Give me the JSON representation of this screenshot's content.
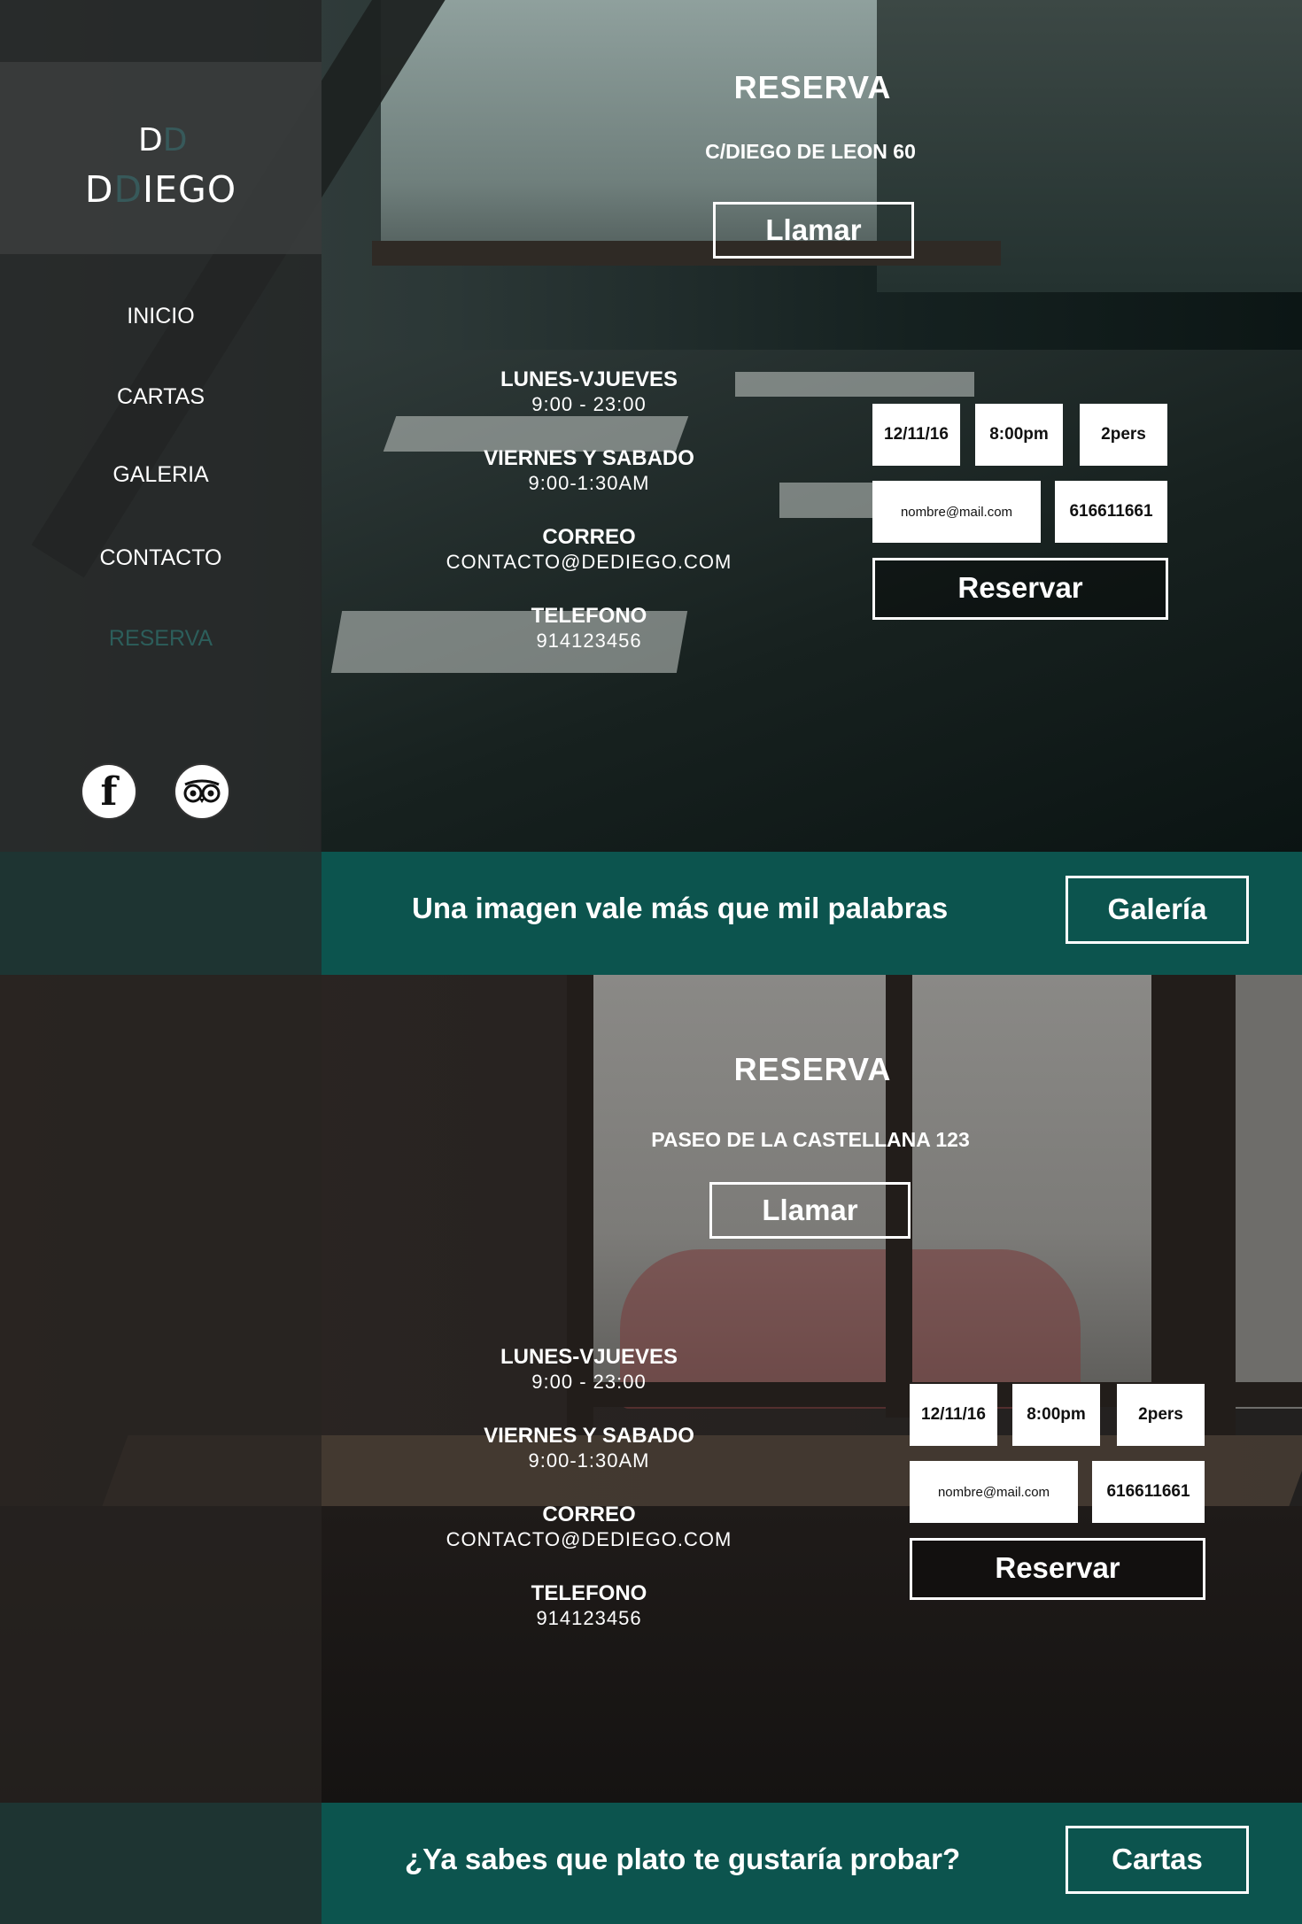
{
  "brand": {
    "mark_first": "D",
    "mark_second": "D",
    "name_first": "D",
    "name_second": "D",
    "name_rest": "IEGO"
  },
  "sidebar": {
    "nav": [
      {
        "label": "INICIO"
      },
      {
        "label": "CARTAS"
      },
      {
        "label": "GALERIA"
      },
      {
        "label": "CONTACTO"
      },
      {
        "label": "RESERVA",
        "active": true
      }
    ],
    "social": {
      "facebook_glyph": "f",
      "facebook_icon": "facebook-icon",
      "tripadvisor_icon": "tripadvisor-icon"
    }
  },
  "section1": {
    "title": "RESERVA",
    "address": "C/DIEGO DE LEON 60",
    "call_label": "Llamar",
    "hours": [
      {
        "heading": "LUNES-VJUEVES",
        "value": "9:00 - 23:00"
      },
      {
        "heading": "VIERNES Y SABADO",
        "value": "9:00-1:30AM"
      },
      {
        "heading": "CORREO",
        "value": "CONTACTO@DEDIEGO.COM"
      },
      {
        "heading": "TELEFONO",
        "value": "914123456"
      }
    ],
    "form": {
      "date": "12/11/16",
      "time": "8:00pm",
      "people": "2pers",
      "email": "nombre@mail.com",
      "phone": "616611661",
      "submit": "Reservar"
    }
  },
  "banner1": {
    "text": "Una imagen vale más que mil palabras",
    "button": "Galería"
  },
  "section2": {
    "title": "RESERVA",
    "address": "PASEO DE LA CASTELLANA 123",
    "call_label": "Llamar",
    "hours": [
      {
        "heading": "LUNES-VJUEVES",
        "value": "9:00 - 23:00"
      },
      {
        "heading": "VIERNES Y SABADO",
        "value": "9:00-1:30AM"
      },
      {
        "heading": "CORREO",
        "value": "CONTACTO@DEDIEGO.COM"
      },
      {
        "heading": "TELEFONO",
        "value": "914123456"
      }
    ],
    "form": {
      "date": "12/11/16",
      "time": "8:00pm",
      "people": "2pers",
      "email": "nombre@mail.com",
      "phone": "616611661",
      "submit": "Reservar"
    }
  },
  "banner2": {
    "text": "¿Ya sabes que plato te gustaría probar?",
    "button": "Cartas"
  },
  "colors": {
    "accent": "#0c544e",
    "active_nav": "#2c5e5b",
    "logo_dim": "#37595a"
  }
}
